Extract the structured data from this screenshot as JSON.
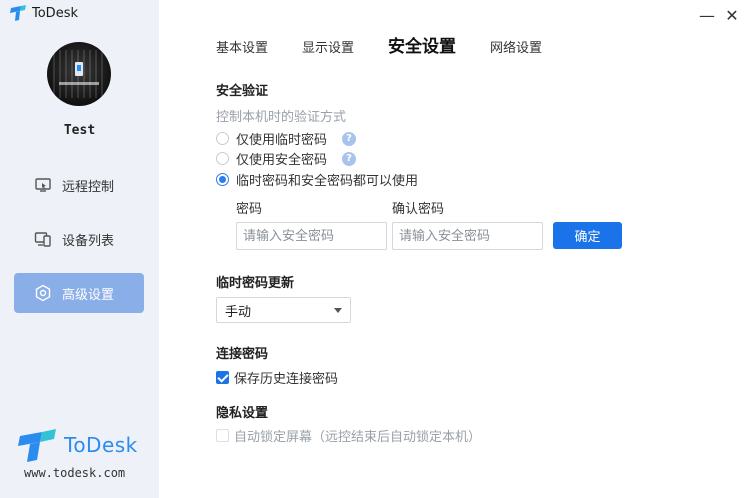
{
  "app": {
    "title": "ToDesk"
  },
  "window": {
    "minimize": "—",
    "close": "✕"
  },
  "user": {
    "name": "Test"
  },
  "sidebar": {
    "items": [
      {
        "label": "远程控制",
        "icon": "remote-control-icon"
      },
      {
        "label": "设备列表",
        "icon": "device-list-icon"
      },
      {
        "label": "高级设置",
        "icon": "settings-icon"
      }
    ]
  },
  "brand": {
    "name": "ToDesk",
    "url": "www.todesk.com"
  },
  "tabs": [
    {
      "label": "基本设置"
    },
    {
      "label": "显示设置"
    },
    {
      "label": "安全设置"
    },
    {
      "label": "网络设置"
    }
  ],
  "security": {
    "title": "安全验证",
    "subtitle": "控制本机时的验证方式",
    "options": [
      {
        "label": "仅使用临时密码",
        "help": "?"
      },
      {
        "label": "仅使用安全密码",
        "help": "?"
      },
      {
        "label": "临时密码和安全密码都可以使用"
      }
    ],
    "password_label": "密码",
    "password_placeholder": "请输入安全密码",
    "confirm_label": "确认密码",
    "confirm_placeholder": "请输入安全密码",
    "confirm_button": "确定"
  },
  "temp_password": {
    "title": "临时密码更新",
    "selected": "手动"
  },
  "connect_password": {
    "title": "连接密码",
    "save_history_label": "保存历史连接密码"
  },
  "privacy": {
    "title": "隐私设置",
    "auto_lock_label": "自动锁定屏幕（远控结束后自动锁定本机）"
  },
  "colors": {
    "accent": "#1a73e8",
    "sidebar_active": "#8aaee7",
    "sidebar_bg": "#eef2f8",
    "brand": "#2b8cf0"
  }
}
